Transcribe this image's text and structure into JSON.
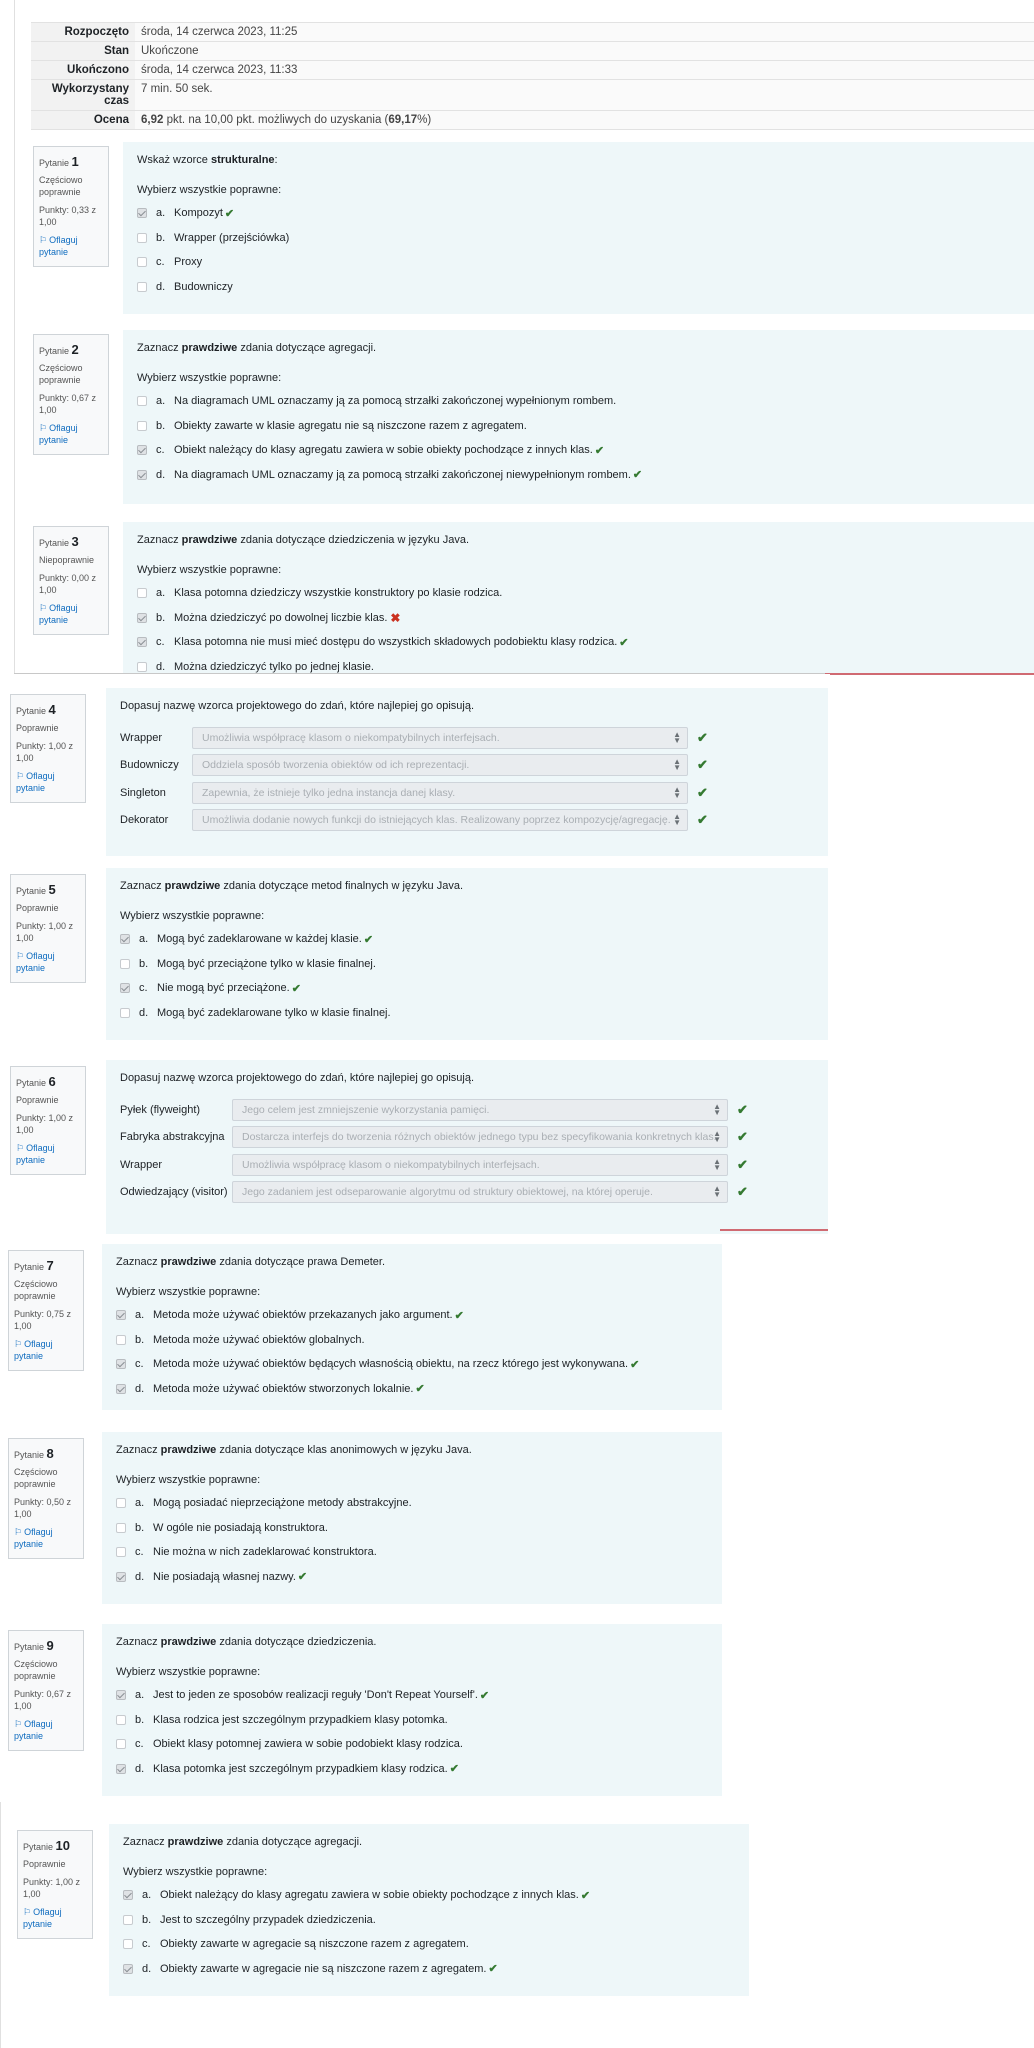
{
  "summary": [
    {
      "label": "Rozpoczęto",
      "value": "środa, 14 czerwca 2023, 11:25"
    },
    {
      "label": "Stan",
      "value": "Ukończone"
    },
    {
      "label": "Ukończono",
      "value": "środa, 14 czerwca 2023, 11:33"
    },
    {
      "label": "Wykorzystany czas",
      "value": "7 min. 50 sek."
    },
    {
      "label": "Ocena",
      "value_pre": "6,92",
      "value_mid": " pkt. na 10,00 pkt. możliwych do uzyskania (",
      "value_pct": "69,17",
      "value_post": "%)"
    }
  ],
  "labels": {
    "pytanie": "Pytanie",
    "flag": "Oflaguj pytanie",
    "flag_icon": "flag-icon",
    "prompt": "Wybierz wszystkie poprawne:",
    "check_icon": "✔",
    "cross_icon": "✖"
  },
  "colors": {
    "correct": "#357a32",
    "incorrect": "#ca3120",
    "content_bg": "#eef7f9",
    "link": "#0f6cbf"
  },
  "questions": [
    {
      "num": "1",
      "state": "Częściowo poprawnie",
      "grade": "Punkty: 0,33 z 1,00",
      "text_pre": "Wskaż wzorce ",
      "text_bold": "strukturalne",
      "text_post": ":",
      "answers": [
        {
          "letter": "a.",
          "text": "Kompozyt",
          "checked": true,
          "mark": "ok"
        },
        {
          "letter": "b.",
          "text": "Wrapper (przejściówka)",
          "checked": false,
          "mark": ""
        },
        {
          "letter": "c.",
          "text": "Proxy",
          "checked": false,
          "mark": ""
        },
        {
          "letter": "d.",
          "text": "Budowniczy",
          "checked": false,
          "mark": ""
        }
      ]
    },
    {
      "num": "2",
      "state": "Częściowo poprawnie",
      "grade": "Punkty: 0,67 z 1,00",
      "text_pre": "Zaznacz ",
      "text_bold": "prawdziwe",
      "text_post": " zdania dotyczące agregacji.",
      "answers": [
        {
          "letter": "a.",
          "text": "Na diagramach UML oznaczamy ją za pomocą strzałki zakończonej wypełnionym rombem.",
          "checked": false,
          "mark": ""
        },
        {
          "letter": "b.",
          "text": "Obiekty zawarte w klasie agregatu nie są niszczone razem z agregatem.",
          "checked": false,
          "mark": ""
        },
        {
          "letter": "c.",
          "text": "Obiekt należący do klasy agregatu zawiera w sobie obiekty pochodzące z innych klas.",
          "checked": true,
          "mark": "ok"
        },
        {
          "letter": "d.",
          "text": "Na diagramach UML oznaczamy ją za pomocą strzałki zakończonej niewypełnionym rombem.",
          "checked": true,
          "mark": "ok"
        }
      ]
    },
    {
      "num": "3",
      "state": "Niepoprawnie",
      "grade": "Punkty: 0,00 z 1,00",
      "text_pre": "Zaznacz ",
      "text_bold": "prawdziwe",
      "text_post": " zdania dotyczące dziedziczenia w języku Java.",
      "answers": [
        {
          "letter": "a.",
          "text": "Klasa potomna dziedziczy wszystkie konstruktory po klasie rodzica.",
          "checked": false,
          "mark": ""
        },
        {
          "letter": "b.",
          "text": "Można dziedziczyć po dowolnej liczbie klas.",
          "checked": true,
          "mark": "bad"
        },
        {
          "letter": "c.",
          "text": "Klasa potomna nie musi mieć dostępu do wszystkich składowych podobiektu klasy rodzica.",
          "checked": true,
          "mark": "ok"
        },
        {
          "letter": "d.",
          "text": "Można dziedziczyć tylko po jednej klasie.",
          "checked": false,
          "mark": ""
        }
      ]
    },
    {
      "num": "4",
      "state": "Poprawnie",
      "grade": "Punkty: 1,00 z 1,00",
      "text_pre": "Dopasuj nazwę wzorca projektowego do zdań, które najlepiej go opisują.",
      "text_bold": "",
      "text_post": "",
      "matches": [
        {
          "label": "Wrapper",
          "value": "Umożliwia współpracę klasom o niekompatybilnych interfejsach."
        },
        {
          "label": "Budowniczy",
          "value": "Oddziela sposób tworzenia obiektów od ich reprezentacji."
        },
        {
          "label": "Singleton",
          "value": "Zapewnia, że istnieje tylko jedna instancja danej klasy."
        },
        {
          "label": "Dekorator",
          "value": "Umożliwia dodanie nowych funkcji do istniejących klas. Realizowany poprzez kompozycję/agregację."
        }
      ]
    },
    {
      "num": "5",
      "state": "Poprawnie",
      "grade": "Punkty: 1,00 z 1,00",
      "text_pre": "Zaznacz ",
      "text_bold": "prawdziwe",
      "text_post": " zdania dotyczące metod finalnych w języku Java.",
      "answers": [
        {
          "letter": "a.",
          "text": "Mogą być zadeklarowane w każdej klasie.",
          "checked": true,
          "mark": "ok"
        },
        {
          "letter": "b.",
          "text": "Mogą być przeciążone tylko w klasie finalnej.",
          "checked": false,
          "mark": ""
        },
        {
          "letter": "c.",
          "text": "Nie mogą być przeciążone.",
          "checked": true,
          "mark": "ok"
        },
        {
          "letter": "d.",
          "text": "Mogą być zadeklarowane tylko w klasie finalnej.",
          "checked": false,
          "mark": ""
        }
      ]
    },
    {
      "num": "6",
      "state": "Poprawnie",
      "grade": "Punkty: 1,00 z 1,00",
      "text_pre": "Dopasuj nazwę wzorca projektowego do zdań, które najlepiej go opisują.",
      "text_bold": "",
      "text_post": "",
      "matches": [
        {
          "label": "Pyłek (flyweight)",
          "value": "Jego celem jest zmniejszenie wykorzystania pamięci."
        },
        {
          "label": "Fabryka abstrakcyjna",
          "value": "Dostarcza interfejs do tworzenia różnych obiektów jednego typu bez specyfikowania konkretnych klas."
        },
        {
          "label": "Wrapper",
          "value": "Umożliwia współpracę klasom o niekompatybilnych interfejsach."
        },
        {
          "label": "Odwiedzający (visitor)",
          "value": "Jego zadaniem jest odseparowanie algorytmu od struktury obiektowej, na której operuje."
        }
      ]
    },
    {
      "num": "7",
      "state": "Częściowo poprawnie",
      "grade": "Punkty: 0,75 z 1,00",
      "text_pre": "Zaznacz ",
      "text_bold": "prawdziwe",
      "text_post": " zdania dotyczące prawa Demeter.",
      "answers": [
        {
          "letter": "a.",
          "text": "Metoda może używać obiektów przekazanych jako argument.",
          "checked": true,
          "mark": "ok"
        },
        {
          "letter": "b.",
          "text": "Metoda może używać obiektów globalnych.",
          "checked": false,
          "mark": ""
        },
        {
          "letter": "c.",
          "text": "Metoda może używać obiektów będących własnością obiektu, na rzecz którego jest wykonywana.",
          "checked": true,
          "mark": "ok"
        },
        {
          "letter": "d.",
          "text": "Metoda może używać obiektów stworzonych lokalnie.",
          "checked": true,
          "mark": "ok"
        }
      ]
    },
    {
      "num": "8",
      "state": "Częściowo poprawnie",
      "grade": "Punkty: 0,50 z 1,00",
      "text_pre": "Zaznacz ",
      "text_bold": "prawdziwe",
      "text_post": " zdania dotyczące klas anonimowych w języku Java.",
      "answers": [
        {
          "letter": "a.",
          "text": "Mogą posiadać nieprzeciążone metody abstrakcyjne.",
          "checked": false,
          "mark": ""
        },
        {
          "letter": "b.",
          "text": "W ogóle nie posiadają konstruktora.",
          "checked": false,
          "mark": ""
        },
        {
          "letter": "c.",
          "text": "Nie można w nich zadeklarować konstruktora.",
          "checked": false,
          "mark": ""
        },
        {
          "letter": "d.",
          "text": "Nie posiadają własnej nazwy.",
          "checked": true,
          "mark": "ok"
        }
      ]
    },
    {
      "num": "9",
      "state": "Częściowo poprawnie",
      "grade": "Punkty: 0,67 z 1,00",
      "text_pre": "Zaznacz ",
      "text_bold": "prawdziwe",
      "text_post": " zdania dotyczące dziedziczenia.",
      "answers": [
        {
          "letter": "a.",
          "text": "Jest to jeden ze sposobów realizacji reguły 'Don't Repeat Yourself'.",
          "checked": true,
          "mark": "ok"
        },
        {
          "letter": "b.",
          "text": "Klasa rodzica jest szczególnym przypadkiem klasy potomka.",
          "checked": false,
          "mark": ""
        },
        {
          "letter": "c.",
          "text": "Obiekt klasy potomnej zawiera w sobie podobiekt klasy rodzica.",
          "checked": false,
          "mark": ""
        },
        {
          "letter": "d.",
          "text": "Klasa potomka jest szczególnym przypadkiem klasy rodzica.",
          "checked": true,
          "mark": "ok"
        }
      ]
    },
    {
      "num": "10",
      "state": "Poprawnie",
      "grade": "Punkty: 1,00 z 1,00",
      "text_pre": "Zaznacz ",
      "text_bold": "prawdziwe",
      "text_post": " zdania dotyczące agregacji.",
      "answers": [
        {
          "letter": "a.",
          "text": "Obiekt należący do klasy agregatu zawiera w sobie obiekty pochodzące z innych klas.",
          "checked": true,
          "mark": "ok"
        },
        {
          "letter": "b.",
          "text": "Jest to szczególny przypadek dziedziczenia.",
          "checked": false,
          "mark": ""
        },
        {
          "letter": "c.",
          "text": "Obiekty zawarte w agregacie są niszczone razem z agregatem.",
          "checked": false,
          "mark": ""
        },
        {
          "letter": "d.",
          "text": "Obiekty zawarte w agregacie nie są niszczone razem z agregatem.",
          "checked": true,
          "mark": "ok"
        }
      ]
    }
  ]
}
